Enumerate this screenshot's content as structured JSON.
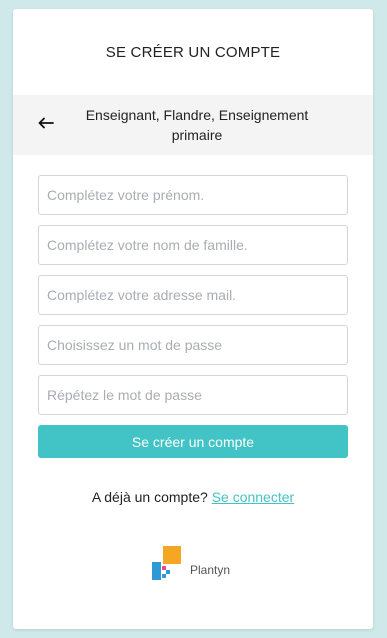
{
  "header": {
    "title": "SE CRÉER UN COMPTE"
  },
  "context": {
    "back_icon": "arrow-left-icon",
    "description": "Enseignant, Flandre, Enseignement primaire"
  },
  "form": {
    "first_name": {
      "placeholder": "Complétez votre prénom.",
      "value": ""
    },
    "last_name": {
      "placeholder": "Complétez votre nom de famille.",
      "value": ""
    },
    "email": {
      "placeholder": "Complétez votre adresse mail.",
      "value": ""
    },
    "password": {
      "placeholder": "Choisissez un mot de passe",
      "value": ""
    },
    "password_repeat": {
      "placeholder": "Répétez le mot de passe",
      "value": ""
    },
    "submit_label": "Se créer un compte"
  },
  "login": {
    "prompt": "A déjà un compte?",
    "link_label": "Se connecter"
  },
  "brand": {
    "name": "Plantyn",
    "logo_icon": "plantyn-logo-icon"
  },
  "colors": {
    "background": "#cfe9ea",
    "accent": "#42c3c5",
    "context_bar": "#f4f4f4",
    "logo_orange": "#f5a623",
    "logo_blue": "#2d9ad6",
    "logo_pink": "#e84a8a"
  }
}
